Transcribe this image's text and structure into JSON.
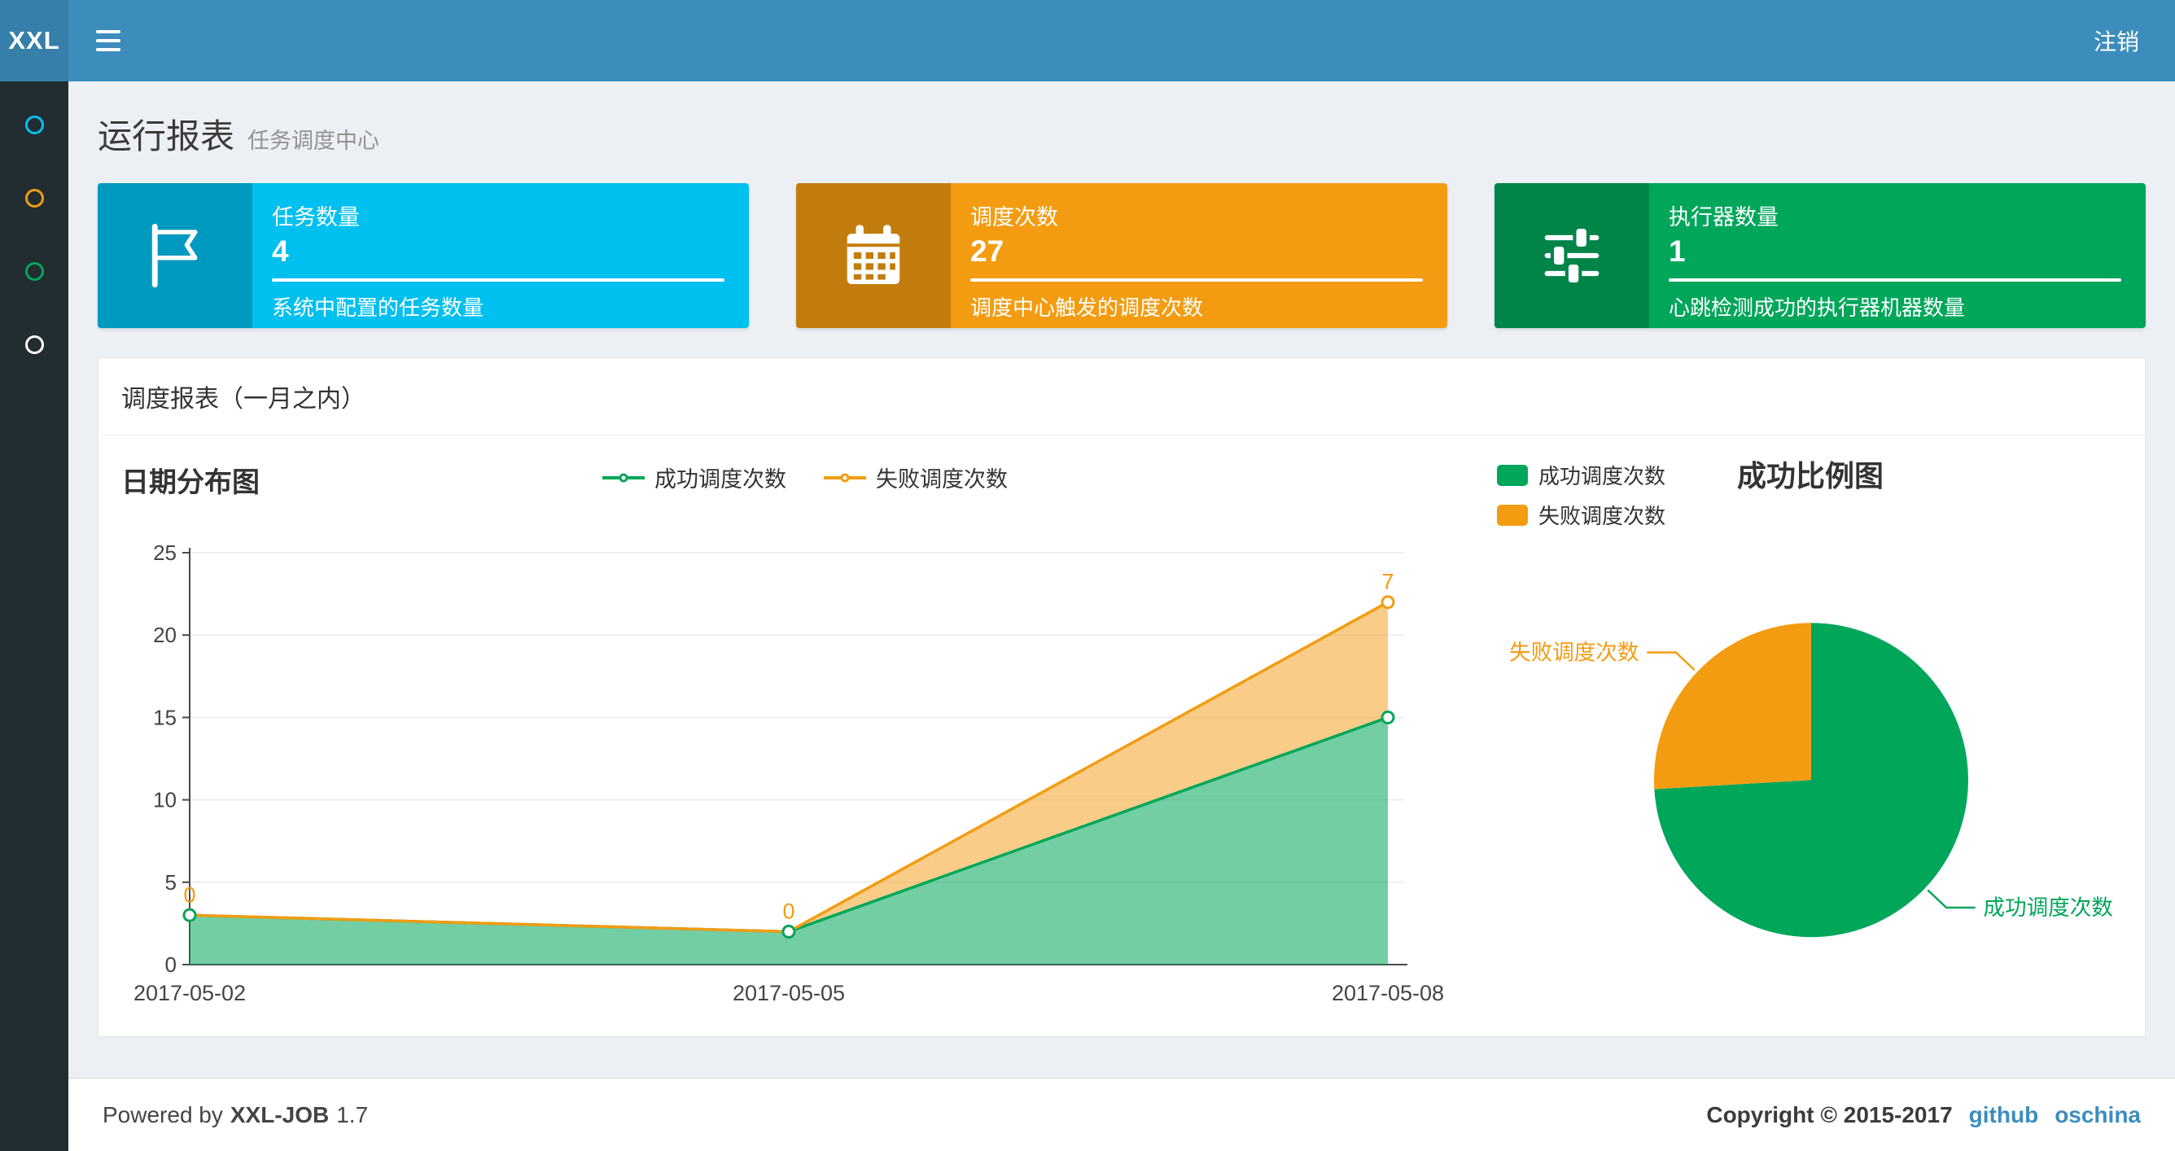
{
  "theme": {
    "navbar": "#3c8dbc",
    "navbar_logo": "#367fa9",
    "sidebar": "#222d32",
    "background": "#ecf0f5",
    "link": "#3c8dbc"
  },
  "navbar": {
    "logo": "XXL",
    "menu_icon": "hamburger-icon",
    "logout": "注销"
  },
  "sidebar": {
    "items": [
      {
        "icon": "circle-icon",
        "color": "#00c0ef"
      },
      {
        "icon": "circle-icon",
        "color": "#f39c12"
      },
      {
        "icon": "circle-icon",
        "color": "#00a65a"
      },
      {
        "icon": "circle-icon",
        "color": "#ffffff"
      }
    ]
  },
  "page_header": {
    "title": "运行报表",
    "subtitle": "任务调度中心"
  },
  "info_boxes": [
    {
      "title": "任务数量",
      "number": "4",
      "description": "系统中配置的任务数量",
      "color": "#00c0ef",
      "icon": "flag-icon"
    },
    {
      "title": "调度次数",
      "number": "27",
      "description": "调度中心触发的调度次数",
      "color": "#f39c12",
      "icon": "calendar-icon"
    },
    {
      "title": "执行器数量",
      "number": "1",
      "description": "心跳检测成功的执行器机器数量",
      "color": "#00a65a",
      "icon": "sliders-icon"
    }
  ],
  "report_panel": {
    "title": "调度报表（一月之内）"
  },
  "chart_data": [
    {
      "type": "area",
      "title": "日期分布图",
      "x": [
        "2017-05-02",
        "2017-05-05",
        "2017-05-08"
      ],
      "series": [
        {
          "name": "成功调度次数",
          "values": [
            3,
            2,
            15
          ],
          "color": "#00a65a"
        },
        {
          "name": "失败调度次数",
          "values": [
            0,
            0,
            7
          ],
          "color": "#f39c12"
        }
      ],
      "stacked": true,
      "ylim": [
        0,
        25
      ],
      "yticks": [
        0,
        5,
        10,
        15,
        20,
        25
      ],
      "point_labels_series": "失败调度次数",
      "point_labels": [
        0,
        0,
        7
      ],
      "legend_position": "top-center",
      "grid": true
    },
    {
      "type": "pie",
      "title": "成功比例图",
      "slices": [
        {
          "name": "成功调度次数",
          "value": 20,
          "color": "#00a65a"
        },
        {
          "name": "失败调度次数",
          "value": 7,
          "color": "#f39c12"
        }
      ],
      "legend_position": "top-left",
      "start_angle": "top-clockwise"
    }
  ],
  "footer": {
    "powered_prefix": "Powered by",
    "product": "XXL-JOB",
    "version": "1.7",
    "copyright": "Copyright © 2015-2017",
    "links": [
      "github",
      "oschina"
    ]
  }
}
